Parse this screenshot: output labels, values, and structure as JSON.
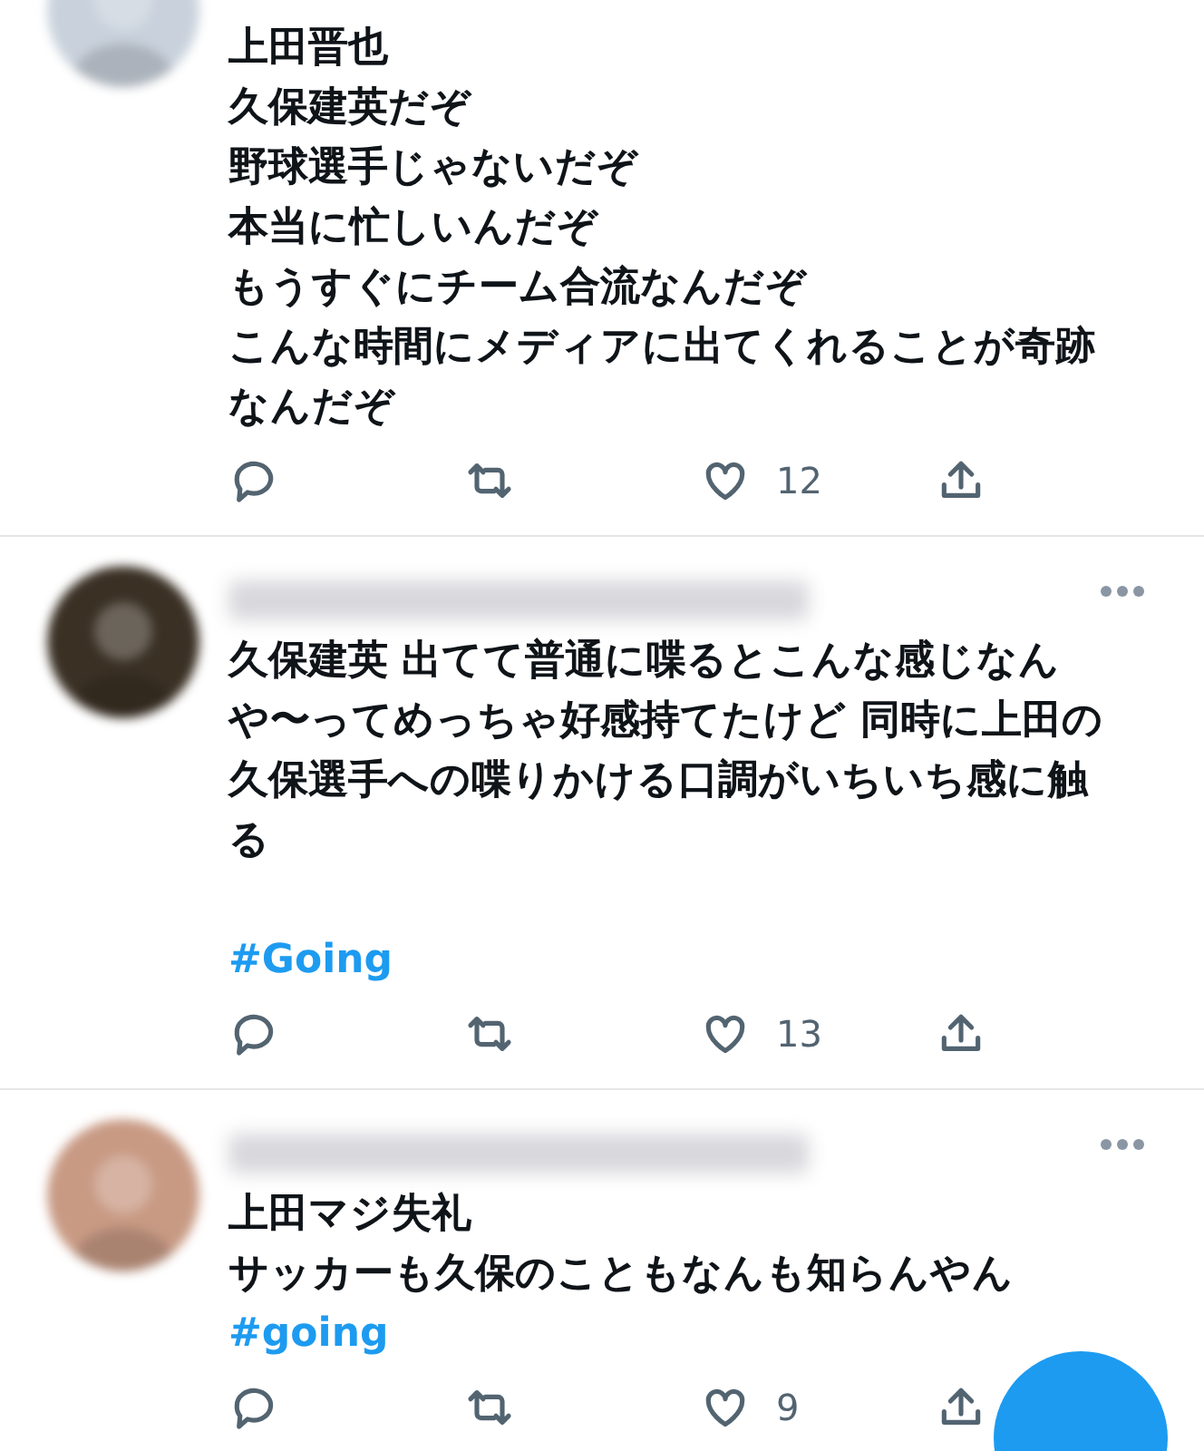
{
  "tweets": [
    {
      "kind": "top_cut",
      "lines": [
        "上田晋也",
        "久保建英だぞ",
        "野球選手じゃないだぞ",
        "本当に忙しいんだぞ",
        "もうすぐにチーム合流なんだぞ",
        "こんな時間にメディアに出てくれることが奇跡なんだぞ"
      ],
      "like_count": "12"
    },
    {
      "kind": "hashtag_after_blank",
      "lines": [
        "久保建英 出てて普通に喋るとこんな感じなんや〜ってめっちゃ好感持てたけど 同時に上田の久保選手への喋りかける口調がいちいち感に触る"
      ],
      "hashtag": "#Going",
      "like_count": "13"
    },
    {
      "kind": "plain",
      "lines": [
        "上田マジ失礼",
        "サッカーも久保のこともなんも知らんやん"
      ],
      "hashtag": "#going",
      "like_count": "9"
    }
  ]
}
